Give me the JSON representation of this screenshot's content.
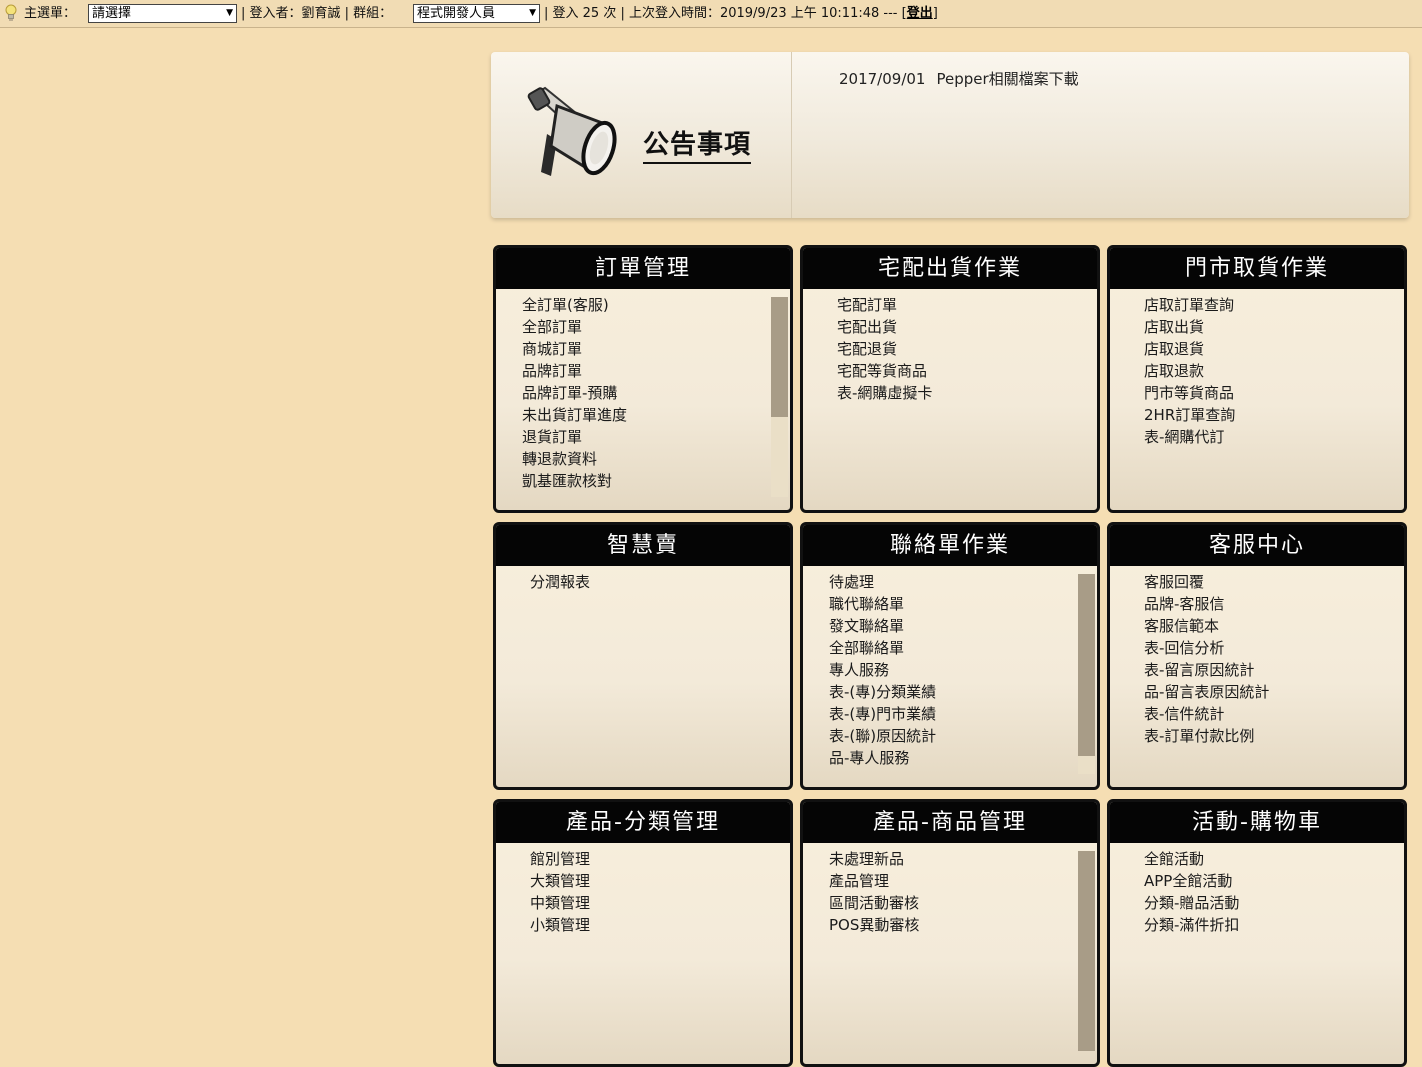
{
  "topbar": {
    "menu_label": "主選單：",
    "menu_select": "請選擇",
    "login_user_label": "| 登入者：劉育誠 | 群組：",
    "group_select": "程式開發人員",
    "login_info": "| 登入 25 次 | 上次登入時間：2019/9/23 上午 10:11:48 --- [",
    "logout": "登出",
    "close_bracket": "]"
  },
  "announcement": {
    "title": "公告事項",
    "items": [
      {
        "date": "2017/09/01",
        "text": "Pepper相關檔案下載"
      }
    ]
  },
  "panels": [
    {
      "title": "訂單管理",
      "scrollbar": true,
      "items": [
        "全訂單(客服)",
        "全部訂單",
        "商城訂單",
        "品牌訂單",
        "品牌訂單-預購",
        "未出貨訂單進度",
        "退貨訂單",
        "轉退款資料",
        "凱基匯款核對"
      ]
    },
    {
      "title": "宅配出貨作業",
      "scrollbar": false,
      "items": [
        "宅配訂單",
        "宅配出貨",
        "宅配退貨",
        "宅配等貨商品",
        "表-網購虛擬卡"
      ]
    },
    {
      "title": "門市取貨作業",
      "scrollbar": false,
      "items": [
        "店取訂單查詢",
        "店取出貨",
        "店取退貨",
        "店取退款",
        "門市等貨商品",
        "2HR訂單查詢",
        "表-網購代訂"
      ]
    },
    {
      "title": "智慧賣",
      "scrollbar": false,
      "items": [
        "分潤報表"
      ]
    },
    {
      "title": "聯絡單作業",
      "scrollbar": true,
      "items": [
        "待處理",
        "職代聯絡單",
        "發文聯絡單",
        "全部聯絡單",
        "專人服務",
        "表-(專)分類業績",
        "表-(專)門市業績",
        "表-(聯)原因統計",
        "品-專人服務"
      ]
    },
    {
      "title": "客服中心",
      "scrollbar": false,
      "items": [
        "客服回覆",
        "品牌-客服信",
        "客服信範本",
        "表-回信分析",
        "表-留言原因統計",
        "品-留言表原因統計",
        "表-信件統計",
        "表-訂單付款比例"
      ]
    },
    {
      "title": "產品-分類管理",
      "scrollbar": false,
      "items": [
        "館別管理",
        "大類管理",
        "中類管理",
        "小類管理"
      ]
    },
    {
      "title": "產品-商品管理",
      "scrollbar": true,
      "items": [
        "未處理新品",
        "產品管理",
        "區間活動審核",
        "POS異動審核"
      ]
    },
    {
      "title": "活動-購物車",
      "scrollbar": false,
      "items": [
        "全館活動",
        "APP全館活動",
        "分類-贈品活動",
        "分類-滿件折扣"
      ]
    }
  ]
}
